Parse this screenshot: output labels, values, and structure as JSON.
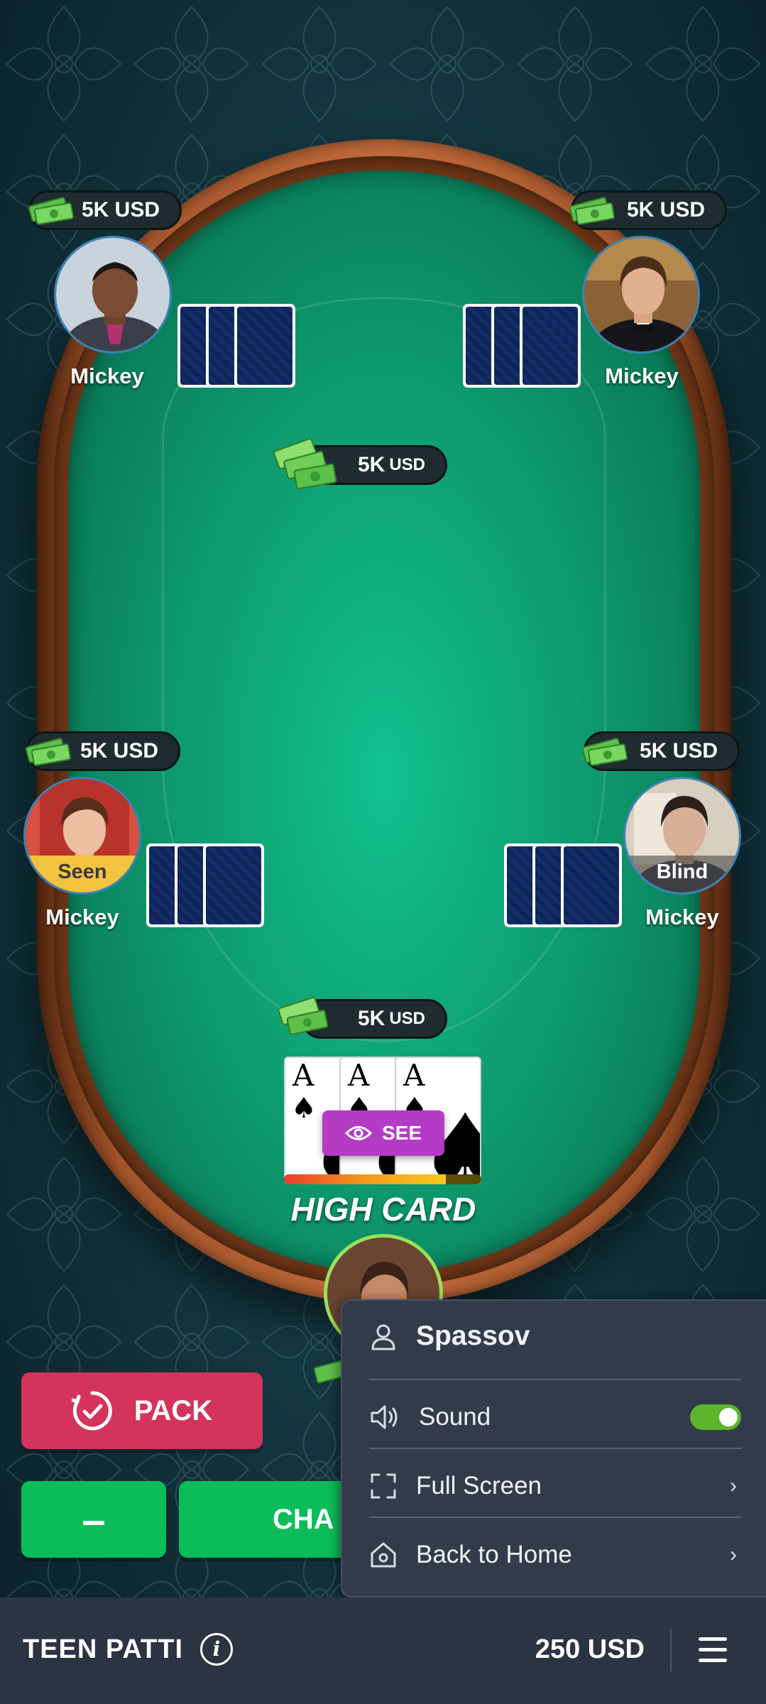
{
  "players": [
    {
      "id": "top-left",
      "name": "Mickey",
      "bet": "5K USD",
      "status": ""
    },
    {
      "id": "top-right",
      "name": "Mickey",
      "bet": "5K USD",
      "status": ""
    },
    {
      "id": "mid-left",
      "name": "Mickey",
      "bet": "5K USD",
      "status": "Seen"
    },
    {
      "id": "mid-right",
      "name": "Mickey",
      "bet": "5K USD",
      "status": "Blind"
    }
  ],
  "pot": {
    "amount": "5K",
    "unit": "USD"
  },
  "my_bet": {
    "amount": "5K",
    "unit": "USD"
  },
  "my_cards": [
    {
      "rank": "A",
      "suit": "♠"
    },
    {
      "rank": "A",
      "suit": "♠"
    },
    {
      "rank": "A",
      "suit": "♠"
    }
  ],
  "see_label": "SEE",
  "hand_name": "HIGH CARD",
  "turn_timer_fraction": 0.82,
  "actions": {
    "pack": "PACK",
    "minus": "–",
    "chaal": "CHA"
  },
  "menu": {
    "username": "Spassov",
    "sound_label": "Sound",
    "sound_on": true,
    "fullscreen_label": "Full Screen",
    "home_label": "Back to Home"
  },
  "bottom_bar": {
    "title": "TEEN PATTI",
    "balance": "250 USD"
  },
  "colors": {
    "pack": "#d4335b",
    "action_green": "#0cbc5a",
    "see_purple": "#b43cc4",
    "toggle_on": "#5bb62c",
    "felt": "#0fa476"
  }
}
